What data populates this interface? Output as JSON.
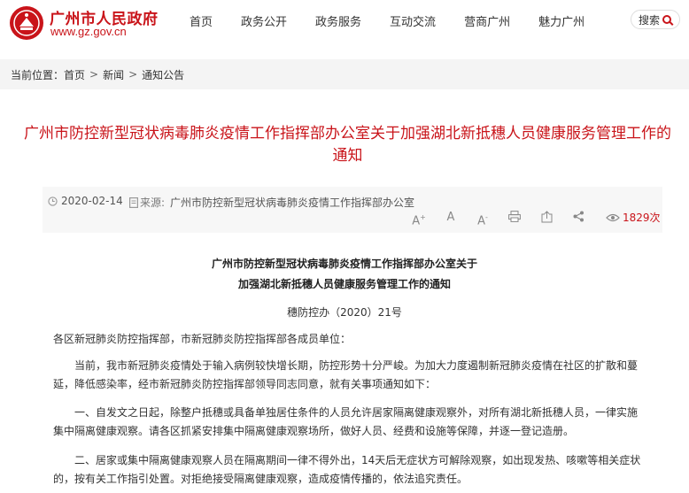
{
  "header": {
    "site_name": "广州市人民政府",
    "site_url": "www.gz.gov.cn",
    "nav": [
      "首页",
      "政务公开",
      "政务服务",
      "互动交流",
      "营商广州",
      "魅力广州"
    ],
    "search_label": "搜索"
  },
  "breadcrumb": {
    "prefix": "当前位置：",
    "items": [
      "首页",
      "新闻",
      "通知公告"
    ],
    "separator": ">"
  },
  "article": {
    "title_line1": "广州市防控新型冠状病毒肺炎疫情工作指挥部办公室关于加强湖北新抵穗人员健康服务管理工作的",
    "title_line2": "通知",
    "date": "2020-02-14",
    "source_label": "来源:",
    "source": "广州市防控新型冠状病毒肺炎疫情工作指挥部办公室",
    "views": "1829次",
    "doc_heading_line1": "广州市防控新型冠状病毒肺炎疫情工作指挥部办公室关于",
    "doc_heading_line2": "加强湖北新抵穗人员健康服务管理工作的通知",
    "doc_number": "穗防控办（2020）21号",
    "paragraphs": [
      "各区新冠肺炎防控指挥部，市新冠肺炎防控指挥部各成员单位：",
      "当前，我市新冠肺炎疫情处于输入病例较快增长期，防控形势十分严峻。为加大力度遏制新冠肺炎疫情在社区的扩散和蔓延，降低感染率，经市新冠肺炎防控指挥部领导同志同意，就有关事项通知如下：",
      "一、自发文之日起，除整户抵穗或具备单独居住条件的人员允许居家隔离健康观察外，对所有湖北新抵穗人员，一律实施集中隔离健康观察。请各区抓紧安排集中隔离健康观察场所，做好人员、经费和设施等保障，并逐一登记造册。",
      "二、居家或集中隔离健康观察人员在隔离期间一律不得外出，14天后无症状方可解除观察，如出现发热、咳嗽等相关症状的，按有关工作指引处置。对拒绝接受隔离健康观察，造成疫情传播的，依法追究责任。"
    ]
  },
  "colors": {
    "brand_red": "#c9141a",
    "breadcrumb_bg": "#f4f4f4",
    "meta_bg": "#f7f7f7"
  },
  "icons": [
    "logo-emblem-icon",
    "search-icon",
    "clock-icon",
    "document-icon",
    "font-increase-icon",
    "font-normal-icon",
    "font-decrease-icon",
    "print-icon",
    "share-export-icon",
    "share-icon",
    "eye-icon"
  ]
}
